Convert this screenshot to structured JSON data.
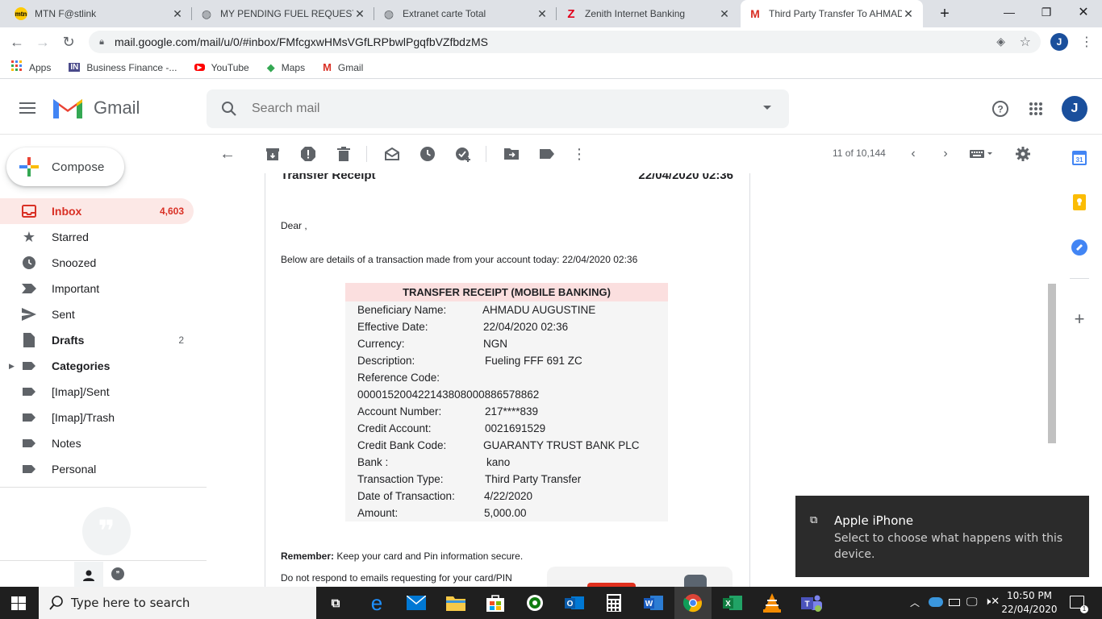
{
  "browser": {
    "tabs": [
      {
        "title": "MTN F@stlink",
        "icon": "mtn-icon"
      },
      {
        "title": "MY PENDING FUEL REQUESTS",
        "icon": "globe-icon"
      },
      {
        "title": "Extranet carte Total",
        "icon": "globe-icon"
      },
      {
        "title": "Zenith Internet Banking",
        "icon": "zenith-icon"
      },
      {
        "title": "Third Party Transfer To AHMAD",
        "icon": "gmail-icon"
      }
    ],
    "url": "mail.google.com/mail/u/0/#inbox/FMfcgxwHMsVGfLRPbwlPgqfbVZfbdzMS",
    "profile_initial": "J",
    "bookmarks": [
      {
        "label": "Apps",
        "icon": "apps-grid-icon"
      },
      {
        "label": "Business Finance -...",
        "icon": "in-icon"
      },
      {
        "label": "YouTube",
        "icon": "youtube-icon"
      },
      {
        "label": "Maps",
        "icon": "maps-icon"
      },
      {
        "label": "Gmail",
        "icon": "gmail-icon"
      }
    ]
  },
  "gmail": {
    "logo_text": "Gmail",
    "search_placeholder": "Search mail",
    "avatar_initial": "J",
    "compose_label": "Compose",
    "nav": [
      {
        "label": "Inbox",
        "count": "4,603",
        "icon": "inbox-icon"
      },
      {
        "label": "Starred",
        "count": "",
        "icon": "star-icon"
      },
      {
        "label": "Snoozed",
        "count": "",
        "icon": "clock-icon"
      },
      {
        "label": "Important",
        "count": "",
        "icon": "important-icon"
      },
      {
        "label": "Sent",
        "count": "",
        "icon": "send-icon"
      },
      {
        "label": "Drafts",
        "count": "2",
        "icon": "draft-icon"
      },
      {
        "label": "Categories",
        "count": "",
        "icon": "label-icon"
      },
      {
        "label": "[Imap]/Sent",
        "count": "",
        "icon": "label-icon"
      },
      {
        "label": "[Imap]/Trash",
        "count": "",
        "icon": "label-icon"
      },
      {
        "label": "Notes",
        "count": "",
        "icon": "label-icon"
      },
      {
        "label": "Personal",
        "count": "",
        "icon": "label-icon"
      }
    ],
    "pager": "11 of 10,144"
  },
  "message": {
    "header_title": "Transfer Receipt",
    "header_date": "22/04/2020 02:36",
    "greeting": "Dear ,",
    "intro": "Below are details of a transaction made from your account today: 22/04/2020 02:36",
    "receipt_title": "TRANSFER RECEIPT (MOBILE BANKING)",
    "rows": [
      {
        "label": "Beneficiary Name:",
        "value": "AHMADU AUGUSTINE"
      },
      {
        "label": "Effective Date:",
        "value": "22/04/2020 02:36"
      },
      {
        "label": "Currency:",
        "value": "NGN"
      },
      {
        "label": "Description:",
        "value": "Fueling FFF 691 ZC"
      },
      {
        "label": "Reference Code:",
        "value": ""
      },
      {
        "label": "000015200422143808000886578862",
        "value": ""
      },
      {
        "label": "Account Number:",
        "value": "217****839"
      },
      {
        "label": "Credit Account:",
        "value": "0021691529"
      },
      {
        "label": "Credit Bank Code:",
        "value": "GUARANTY TRUST BANK PLC"
      },
      {
        "label": "Bank :",
        "value": "kano"
      },
      {
        "label": "Transaction Type:",
        "value": "Third Party Transfer"
      },
      {
        "label": "Date of Transaction:",
        "value": "4/22/2020"
      },
      {
        "label": "Amount:",
        "value": "5,000.00"
      }
    ],
    "remember_label": "Remember:",
    "remember_text": " Keep your card and Pin information secure.",
    "donot_text": "Do not respond to emails requesting for your card/PIN"
  },
  "toast": {
    "title": "Apple iPhone",
    "message": "Select to choose what happens with this device."
  },
  "taskbar": {
    "search_placeholder": "Type here to search",
    "time": "10:50 PM",
    "date": "22/04/2020"
  },
  "colors": {
    "accent_red": "#d93025",
    "inbox_bg": "#fce8e6",
    "receipt_head": "#fbdfdf",
    "avatar": "#1a4f9c"
  }
}
